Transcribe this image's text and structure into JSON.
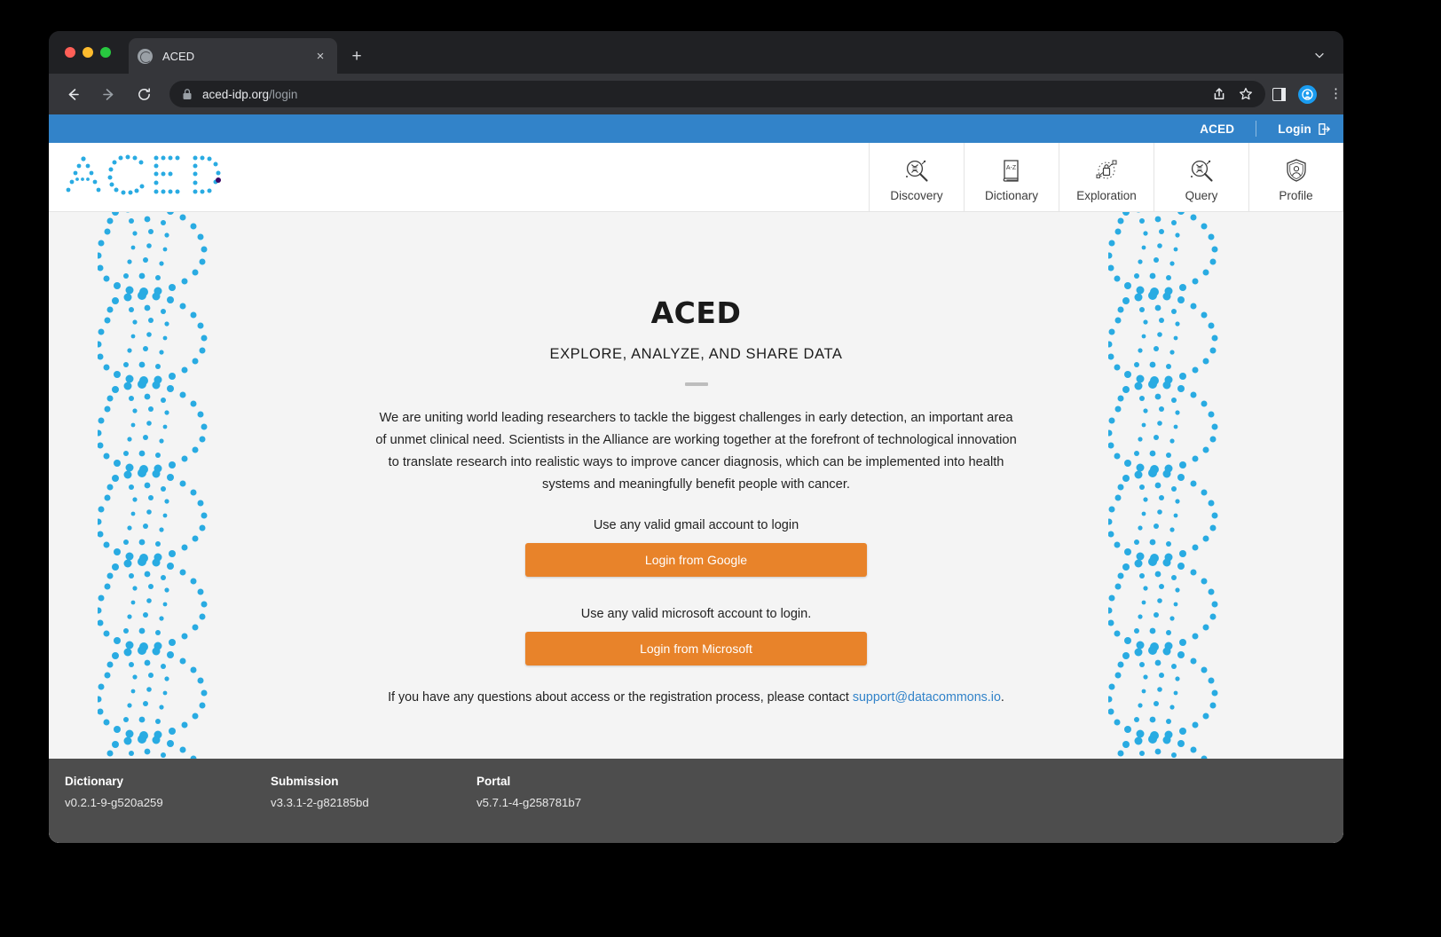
{
  "browser": {
    "tab": {
      "title": "ACED",
      "favicon": "globe-icon",
      "close": "×"
    },
    "newtab_label": "+",
    "url_host": "aced-idp.org",
    "url_path": "/login",
    "nav": {
      "back": "←",
      "forward": "→",
      "reload": "⟳"
    },
    "actions": [
      "share-icon",
      "bookmark-star-icon",
      "side-panel-icon",
      "profile-avatar-icon",
      "chrome-menu-icon"
    ]
  },
  "topbar": {
    "brand": "ACED",
    "login_label": "Login",
    "login_icon": "login-arrow-icon"
  },
  "header": {
    "logo_text": "ACED",
    "nav_items": [
      {
        "label": "Discovery",
        "icon": "magnifier-dna-icon"
      },
      {
        "label": "Dictionary",
        "icon": "book-a-z-icon"
      },
      {
        "label": "Exploration",
        "icon": "network-lock-icon"
      },
      {
        "label": "Query",
        "icon": "magnifier-dna-icon"
      },
      {
        "label": "Profile",
        "icon": "shield-person-icon"
      }
    ]
  },
  "main": {
    "title": "ACED",
    "subtitle": "EXPLORE, ANALYZE, AND SHARE DATA",
    "blurb": "We are uniting world leading researchers to tackle the biggest challenges in early detection, an important area of unmet clinical need. Scientists in the Alliance are working together at the forefront of technological innovation to translate research into realistic ways to improve cancer diagnosis, which can be implemented into health systems and meaningfully benefit people with cancer.",
    "google_hint": "Use any valid gmail account to login",
    "google_button": "Login from Google",
    "microsoft_hint": "Use any valid microsoft account to login.",
    "microsoft_button": "Login from Microsoft",
    "contact_prefix": "If you have any questions about access or the registration process, please contact ",
    "contact_email": "support@datacommons.io",
    "contact_suffix": "."
  },
  "footer": {
    "columns": [
      {
        "title": "Dictionary",
        "version": "v0.2.1-9-g520a259"
      },
      {
        "title": "Submission",
        "version": "v3.3.1-2-g82185bd"
      },
      {
        "title": "Portal",
        "version": "v5.7.1-4-g258781b7"
      }
    ]
  },
  "colors": {
    "brand_blue": "#3283c9",
    "button_orange": "#e8832a",
    "footer_gray": "#4d4d4d",
    "helix_blue": "#29abe2",
    "link_blue": "#3283c9"
  }
}
